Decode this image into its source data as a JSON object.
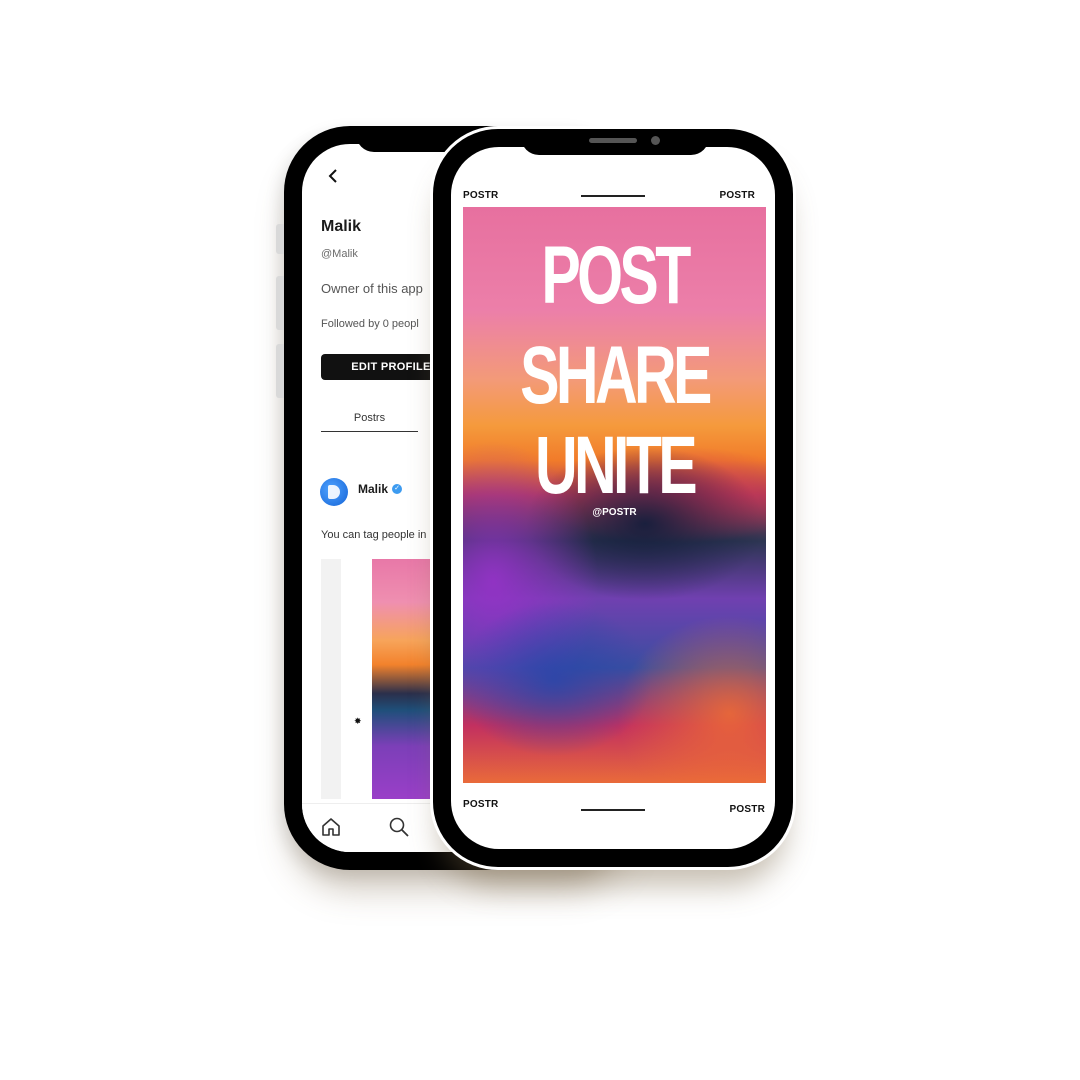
{
  "profile": {
    "name": "Malik",
    "handle": "@Malik",
    "bio": "Owner of this app",
    "followers": "Followed by 0 peopl",
    "edit_button": "EDIT PROFILE",
    "back_icon": "chevron-left-icon"
  },
  "tabs": [
    {
      "label": "Postrs",
      "active": true
    }
  ],
  "post": {
    "author": "Malik",
    "verified": true,
    "text": "You can tag people in"
  },
  "bottom_nav": [
    "home-icon",
    "search-icon"
  ],
  "poster": {
    "top_left": "POSTR",
    "top_right": "POSTR",
    "bottom_left": "POSTR",
    "bottom_right": "POSTR",
    "lines": [
      "POST",
      "SHARE",
      "UNITE"
    ],
    "handle": "@POSTR"
  },
  "colors": {
    "phone_frame": "#000000",
    "button_bg": "#111111",
    "verified_badge": "#3d9bf0",
    "poster_pink": "#e7709f",
    "poster_orange": "#f59a3c",
    "poster_purple": "#7040b0"
  }
}
